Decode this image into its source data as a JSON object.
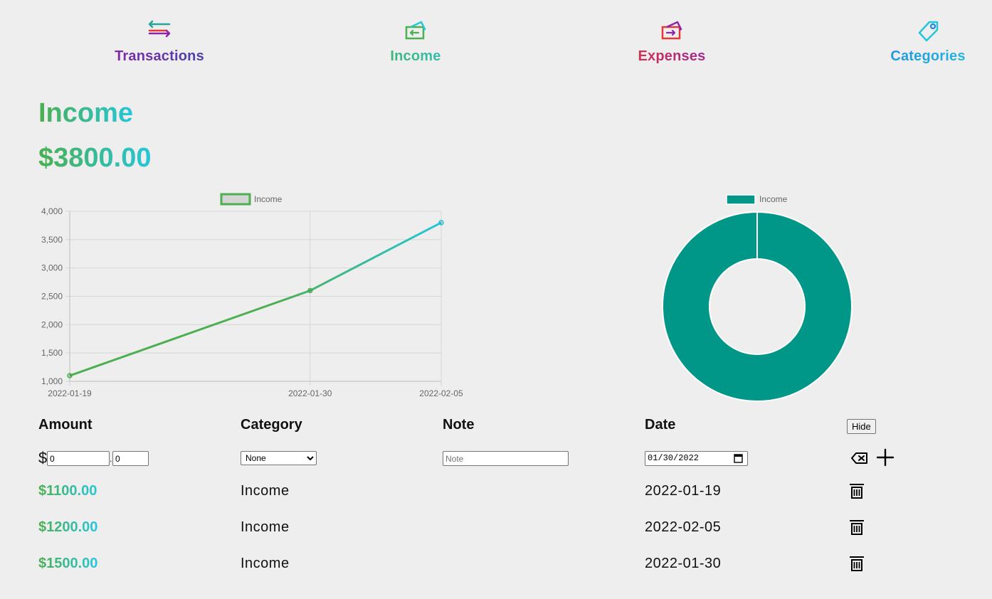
{
  "nav": {
    "transactions": {
      "label": "Transactions",
      "icon": "arrows-exchange-icon"
    },
    "income": {
      "label": "Income",
      "icon": "card-income-icon"
    },
    "expenses": {
      "label": "Expenses",
      "icon": "card-expense-icon"
    },
    "categories": {
      "label": "Categories",
      "icon": "tag-icon"
    }
  },
  "page": {
    "title": "Income",
    "total": "$3800.00"
  },
  "colors": {
    "income_green": "#4caf50",
    "income_teal": "#26c6da",
    "donut_fill": "#009688",
    "axis_text": "#666666"
  },
  "chart_data": [
    {
      "type": "line",
      "x": [
        "2022-01-19",
        "2022-01-30",
        "2022-02-05"
      ],
      "series": [
        {
          "name": "Income",
          "values": [
            1100,
            2600,
            3800
          ]
        }
      ],
      "y_ticks": [
        "4,000",
        "3,500",
        "3,000",
        "2,500",
        "2,000",
        "1,500",
        "1,000"
      ],
      "ylim": [
        1000,
        4000
      ],
      "grid": true,
      "legend": "top-center"
    },
    {
      "type": "pie",
      "categories": [
        "Income"
      ],
      "values": [
        3800
      ],
      "legend": "top-center"
    }
  ],
  "table": {
    "headers": {
      "amount": "Amount",
      "category": "Category",
      "note": "Note",
      "date": "Date"
    },
    "hide_label": "Hide",
    "form": {
      "currency": "$",
      "amount_int": "0",
      "amount_dec": "0",
      "category_selected": "None",
      "note_placeholder": "Note",
      "date_value": "01/30/2022"
    },
    "rows": [
      {
        "amount": "$1100.00",
        "category": "Income",
        "note": "",
        "date": "2022-01-19"
      },
      {
        "amount": "$1200.00",
        "category": "Income",
        "note": "",
        "date": "2022-02-05"
      },
      {
        "amount": "$1500.00",
        "category": "Income",
        "note": "",
        "date": "2022-01-30"
      }
    ]
  }
}
